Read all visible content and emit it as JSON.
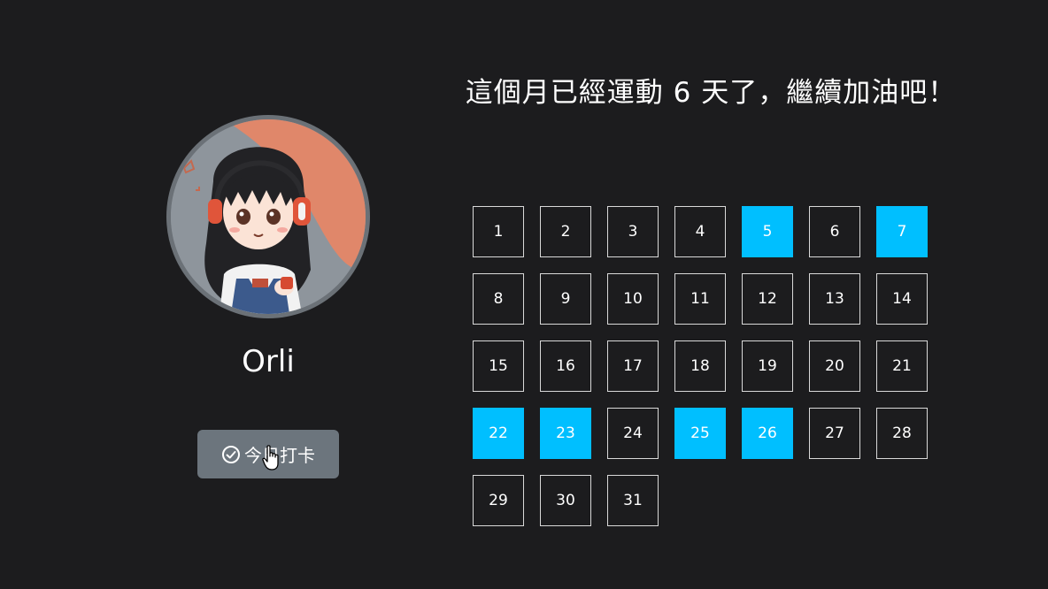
{
  "heading": "這個月已經運動 6 天了，繼續加油吧！",
  "profile": {
    "username": "Orli",
    "avatar_icon": "girl-with-headphones-avatar"
  },
  "checkin_button": {
    "label": "今日打卡",
    "icon": "check-circle-icon"
  },
  "calendar": {
    "days": [
      1,
      2,
      3,
      4,
      5,
      6,
      7,
      8,
      9,
      10,
      11,
      12,
      13,
      14,
      15,
      16,
      17,
      18,
      19,
      20,
      21,
      22,
      23,
      24,
      25,
      26,
      27,
      28,
      29,
      30,
      31
    ],
    "completed_days": [
      5,
      7,
      22,
      23,
      25,
      26
    ]
  },
  "colors": {
    "background": "#1c1c1e",
    "completed": "#00bfff",
    "button": "#6c757d",
    "border": "#d9d9d9"
  }
}
